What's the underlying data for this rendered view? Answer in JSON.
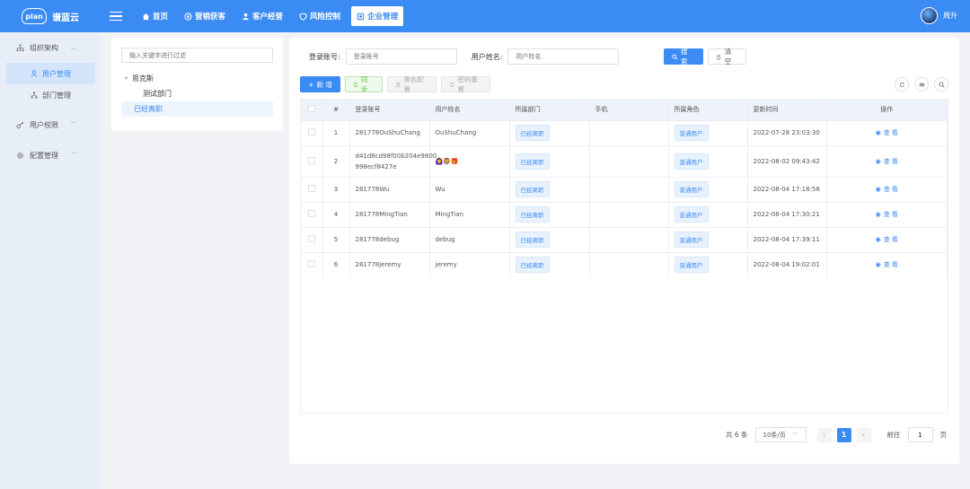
{
  "app": {
    "logo_mark": "plan",
    "name": "谱蓝云"
  },
  "nav": [
    {
      "label": "首页",
      "icon": "home-icon"
    },
    {
      "label": "营销获客",
      "icon": "target-icon"
    },
    {
      "label": "客户经营",
      "icon": "users-icon"
    },
    {
      "label": "风险控制",
      "icon": "shield-icon"
    },
    {
      "label": "企业管理",
      "icon": "building-icon",
      "active": true
    }
  ],
  "user": {
    "name": "周升"
  },
  "sidebar": {
    "groups": [
      {
        "label": "组织架构",
        "expanded": true
      },
      {
        "label": "用户权限"
      },
      {
        "label": "配置管理"
      }
    ],
    "subitems": [
      {
        "label": "用户管理",
        "active": true
      },
      {
        "label": "部门管理"
      }
    ]
  },
  "tree": {
    "search_placeholder": "输入关键字进行过滤",
    "root": "思克斯",
    "children": [
      "测试部门",
      "已经离职"
    ]
  },
  "filters": {
    "account_label": "登录账号:",
    "account_placeholder": "登录账号",
    "name_label": "用户姓名:",
    "name_placeholder": "用户姓名",
    "search_btn": "搜 索",
    "clear_btn": "清 空"
  },
  "actions": {
    "add": "新 增",
    "sync": "同 步",
    "role": "角色配置",
    "reset_pwd": "密码重置"
  },
  "table": {
    "headers": {
      "index": "#",
      "account": "登录账号",
      "name": "用户姓名",
      "dept": "所属部门",
      "phone": "手机",
      "role": "所属角色",
      "updated": "更新时间",
      "ops": "操作"
    },
    "view_label": "查 看",
    "rows": [
      {
        "index": "1",
        "account": "281778OuShuChang",
        "name": "OuShuChang",
        "dept": "已经离职",
        "phone": "",
        "role": "普通用户",
        "updated": "2022-07-28 23:03:30"
      },
      {
        "index": "2",
        "account_line1": "d41d8cd98f00b204e9800",
        "account_line2": "998ecf8427e",
        "name": "🙆‍♀️🦁🎁",
        "dept": "已经离职",
        "phone": "",
        "role": "普通用户",
        "updated": "2022-08-02 09:43:42"
      },
      {
        "index": "3",
        "account": "281778Wu",
        "name": "Wu",
        "dept": "已经离职",
        "phone": "",
        "role": "普通用户",
        "updated": "2022-08-04 17:18:58"
      },
      {
        "index": "4",
        "account": "281778MingTian",
        "name": "MingTian",
        "dept": "已经离职",
        "phone": "",
        "role": "普通用户",
        "updated": "2022-08-04 17:30:21"
      },
      {
        "index": "5",
        "account": "281778debug",
        "name": "debug",
        "dept": "已经离职",
        "phone": "",
        "role": "普通用户",
        "updated": "2022-08-04 17:39:11"
      },
      {
        "index": "6",
        "account": "281778jeremy",
        "name": "jeremy",
        "dept": "已经离职",
        "phone": "",
        "role": "普通用户",
        "updated": "2022-08-04 19:02:01"
      }
    ]
  },
  "pager": {
    "total": "共 6 条",
    "page_size": "10条/页",
    "current": "1",
    "goto_label": "前往",
    "goto_value": "1",
    "page_unit": "页"
  },
  "colors": {
    "primary": "#3b8bf5",
    "success": "#67c23a"
  }
}
